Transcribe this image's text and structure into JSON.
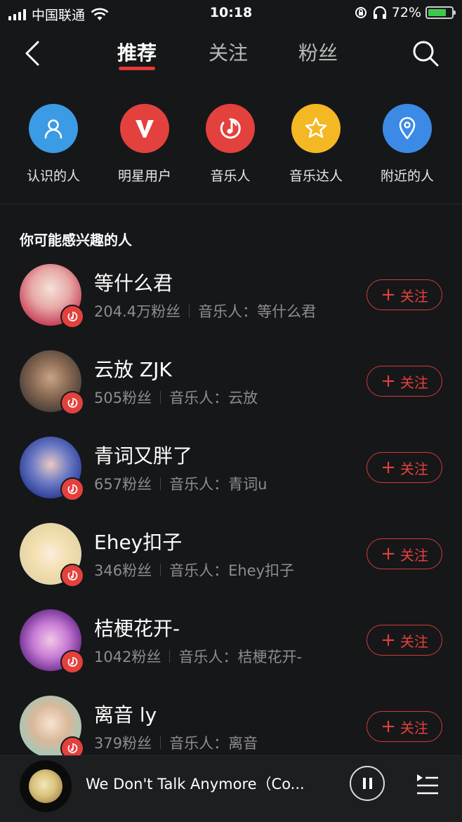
{
  "status": {
    "carrier": "中国联通",
    "time": "10:18",
    "battery": "72%",
    "battery_level": 0.72
  },
  "nav": {
    "tabs": [
      {
        "label": "推荐"
      },
      {
        "label": "关注"
      },
      {
        "label": "粉丝"
      }
    ],
    "active_tab": 0
  },
  "categories": [
    {
      "label": "认识的人",
      "icon": "person-icon",
      "color": "#3b9be4"
    },
    {
      "label": "明星用户",
      "icon": "v-icon",
      "color": "#e3413d"
    },
    {
      "label": "音乐人",
      "icon": "music-note-icon",
      "color": "#e3413d"
    },
    {
      "label": "音乐达人",
      "icon": "star-icon",
      "color": "#f4b824"
    },
    {
      "label": "附近的人",
      "icon": "location-pin-icon",
      "color": "#3b8ae6"
    }
  ],
  "section_title": "你可能感兴趣的人",
  "users": [
    {
      "name": "等什么君",
      "fans": "204.4万粉丝",
      "role": "音乐人：等什么君",
      "follow_label": "关注"
    },
    {
      "name": "云放 ZJK",
      "fans": "505粉丝",
      "role": "音乐人：云放",
      "follow_label": "关注"
    },
    {
      "name": "青词又胖了",
      "fans": "657粉丝",
      "role": "音乐人：青词u",
      "follow_label": "关注"
    },
    {
      "name": "Ehey扣子",
      "fans": "346粉丝",
      "role": "音乐人：Ehey扣子",
      "follow_label": "关注"
    },
    {
      "name": "桔梗花开-",
      "fans": "1042粉丝",
      "role": "音乐人：桔梗花开-",
      "follow_label": "关注"
    },
    {
      "name": "离音 ly",
      "fans": "379粉丝",
      "role": "音乐人：离音",
      "follow_label": "关注"
    }
  ],
  "player": {
    "song": "We Don't Talk Anymore（Co..."
  },
  "colors": {
    "accent": "#e3413d",
    "background": "#161719"
  }
}
